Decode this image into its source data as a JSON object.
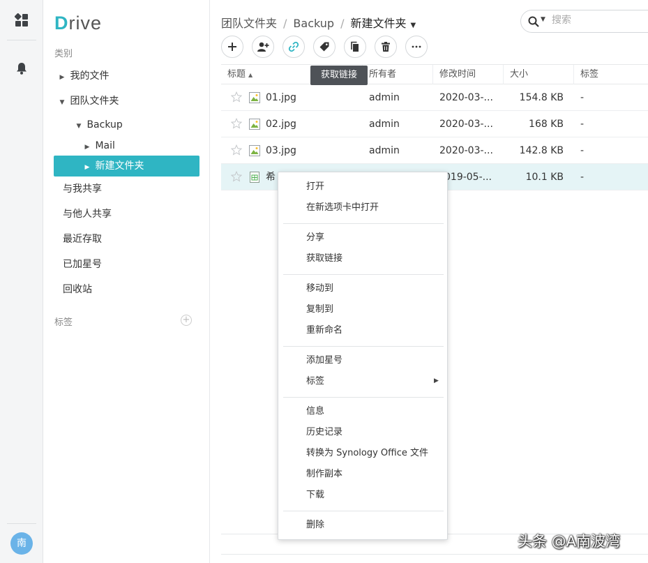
{
  "app": {
    "logo_initial": "D",
    "logo_rest": "rive"
  },
  "user": {
    "avatar_text": "南"
  },
  "sidebar": {
    "category_label": "类别",
    "tree": {
      "my_files": "我的文件",
      "team_folder": "团队文件夹",
      "backup": "Backup",
      "mail": "Mail",
      "new_folder": "新建文件夹"
    },
    "nav": {
      "shared_with_me": "与我共享",
      "shared_with_others": "与他人共享",
      "recent": "最近存取",
      "starred": "已加星号",
      "recycle_bin": "回收站"
    },
    "tags_label": "标签"
  },
  "breadcrumb": {
    "root": "团队文件夹",
    "middle": "Backup",
    "current": "新建文件夹"
  },
  "search": {
    "placeholder": "搜索"
  },
  "toolbar": {
    "tooltip": "获取链接"
  },
  "table": {
    "headers": {
      "title": "标题",
      "owner": "所有者",
      "modified": "修改时间",
      "size": "大小",
      "tags": "标签"
    },
    "rows": [
      {
        "name": "01.jpg",
        "owner": "admin",
        "modified": "2020-03-...",
        "size": "154.8 KB",
        "tags": "-"
      },
      {
        "name": "02.jpg",
        "owner": "admin",
        "modified": "2020-03-...",
        "size": "168 KB",
        "tags": "-"
      },
      {
        "name": "03.jpg",
        "owner": "admin",
        "modified": "2020-03-...",
        "size": "142.8 KB",
        "tags": "-"
      },
      {
        "name": "希",
        "owner": "",
        "modified": "019-05-...",
        "size": "10.1 KB",
        "tags": "-"
      }
    ]
  },
  "context_menu": {
    "open": "打开",
    "open_new_tab": "在新选项卡中打开",
    "share": "分享",
    "get_link": "获取链接",
    "move_to": "移动到",
    "copy_to": "复制到",
    "rename": "重新命名",
    "add_star": "添加星号",
    "tags": "标签",
    "info": "信息",
    "history": "历史记录",
    "convert": "转换为 Synology Office 文件",
    "make_copy": "制作副本",
    "download": "下载",
    "delete": "删除"
  },
  "watermark": "头条 @A南波湾",
  "colors": {
    "accent": "#2fb5c3",
    "selected_row": "#e5f4f6",
    "tooltip_bg": "#4e5257"
  }
}
